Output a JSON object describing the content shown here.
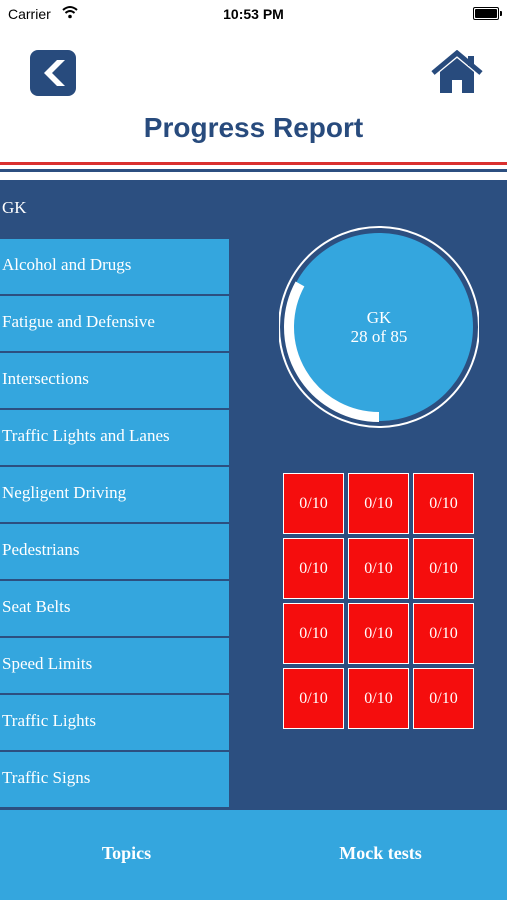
{
  "status_bar": {
    "carrier": "Carrier",
    "time": "10:53 PM"
  },
  "header": {
    "title": "Progress Report",
    "back_icon": "back-arrow-icon",
    "home_icon": "home-icon"
  },
  "colors": {
    "navy": "#2c4f80",
    "sky": "#34a6de",
    "red": "#f50d0d",
    "stripe_red": "#d9302e",
    "title": "#284b7d"
  },
  "gk": {
    "label": "GK"
  },
  "topics": [
    "Alcohol and Drugs",
    "Fatigue and Defensive",
    "Intersections",
    "Traffic Lights and Lanes",
    "Negligent Driving",
    "Pedestrians",
    "Seat Belts",
    "Speed Limits",
    "Traffic Lights",
    "Traffic Signs"
  ],
  "progress": {
    "name": "GK",
    "summary": "28 of 85",
    "completed": 28,
    "total": 85
  },
  "scores": [
    "0/10",
    "0/10",
    "0/10",
    "0/10",
    "0/10",
    "0/10",
    "0/10",
    "0/10",
    "0/10",
    "0/10",
    "0/10",
    "0/10"
  ],
  "tabs": {
    "topics": "Topics",
    "mock": "Mock tests"
  }
}
